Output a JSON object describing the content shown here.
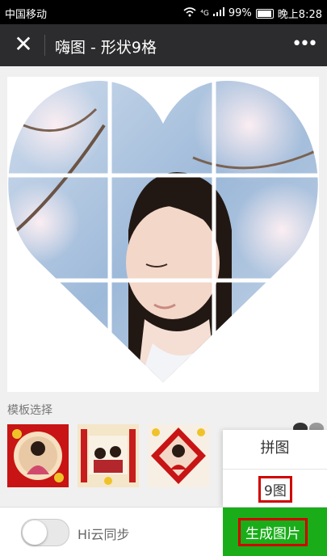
{
  "status_bar": {
    "carrier": "中国移动",
    "network": "⁴G",
    "battery": "99%",
    "time": "晚上8:28"
  },
  "title_bar": {
    "close_icon": "close-icon",
    "title": "嗨图 - 形状9格",
    "more_icon": "more-dots-icon"
  },
  "canvas": {
    "shape": "heart",
    "grid": "3x3",
    "colors": {
      "frame": "#ffffff",
      "sky": "#a9c4e0",
      "blossom": "#f4dbe3",
      "hair": "#201612"
    }
  },
  "template_section": {
    "label": "模板选择",
    "thumbnails": [
      "red-frame-template",
      "scroll-template",
      "diamond-template"
    ]
  },
  "popup_menu": {
    "item_1": "拼图",
    "item_2": "9图"
  },
  "bottom_bar": {
    "sync_label": "Hi云同步",
    "generate_label": "生成图片"
  },
  "colors": {
    "accent_green": "#1aad19",
    "highlight_red": "#d10000"
  }
}
